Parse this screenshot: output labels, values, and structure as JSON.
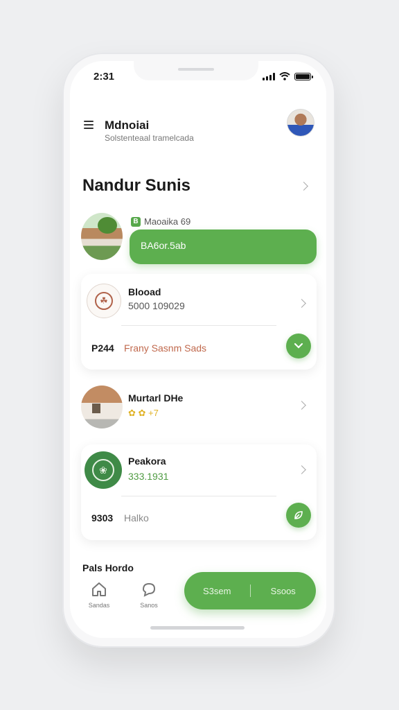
{
  "status": {
    "time": "2:31"
  },
  "header": {
    "title": "Mdnoiai",
    "subtitle": "Solstenteaal tramelcada"
  },
  "section": {
    "title": "Nandur Sunis"
  },
  "featured": {
    "tag_label": "Maoaika 69",
    "tag_icon_text": "B",
    "button_label": "BA6or.5ab"
  },
  "card1": {
    "name": "Blooad",
    "sub": "5000 109029",
    "code": "P244",
    "desc": "Frany Sasnm Sads"
  },
  "item2": {
    "name": "Murtarl DHe",
    "rating": "✿ ✿ +7"
  },
  "card3": {
    "name": "Peakora",
    "sub": "333.1931",
    "code": "9303",
    "desc": "Halko"
  },
  "partial_row": {
    "label": "Pals Hordo"
  },
  "tabbar": {
    "tabs": [
      {
        "label": "Sandas"
      },
      {
        "label": "Sanos"
      }
    ],
    "cta_left": "S3sem",
    "cta_right": "Ssoos"
  },
  "colors": {
    "accent": "#5daf4f",
    "accent_dark": "#3f8a47",
    "desc_orange": "#c0694d",
    "desc_green": "#4f9b42"
  },
  "icons": [
    "menu-icon",
    "chevron-right-icon",
    "check-icon",
    "leaf-icon",
    "home-icon",
    "chat-icon",
    "signal-icon",
    "wifi-icon",
    "battery-icon"
  ]
}
